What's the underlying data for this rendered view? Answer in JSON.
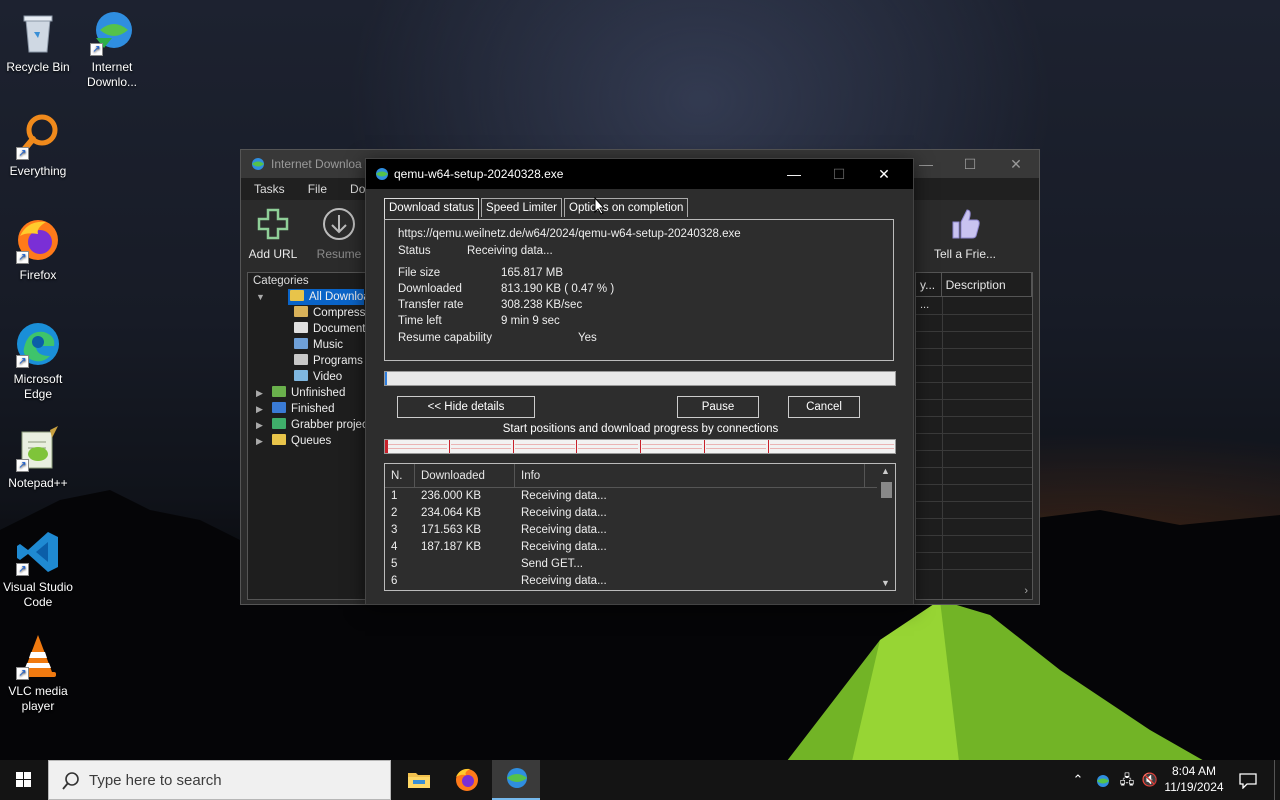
{
  "desktop": {
    "icons": [
      {
        "label": "Recycle Bin",
        "icon": "recycle-bin-icon"
      },
      {
        "label": "Internet Downlo...",
        "icon": "idm-icon"
      },
      {
        "label": "Everything",
        "icon": "everything-search-icon"
      },
      {
        "label": "Firefox",
        "icon": "firefox-icon"
      },
      {
        "label": "Microsoft Edge",
        "icon": "edge-icon"
      },
      {
        "label": "Notepad++",
        "icon": "notepadpp-icon"
      },
      {
        "label": "Visual Studio Code",
        "icon": "vscode-icon"
      },
      {
        "label": "VLC media player",
        "icon": "vlc-icon"
      }
    ]
  },
  "idm_main": {
    "title": "Internet Downloa",
    "menu": [
      "Tasks",
      "File",
      "Dov"
    ],
    "toolbar": {
      "add_url": "Add URL",
      "resume": "Resume",
      "tell_friend": "Tell a Frie..."
    },
    "categories_header": "Categories",
    "tree": [
      {
        "label": "All Downloads",
        "level": 0,
        "expanded": true,
        "selected": true,
        "color": "#e8c44a"
      },
      {
        "label": "Compressed",
        "level": 1,
        "color": "#d9b25a"
      },
      {
        "label": "Documents",
        "level": 1,
        "color": "#e0e0e0"
      },
      {
        "label": "Music",
        "level": 1,
        "color": "#6fa0d8"
      },
      {
        "label": "Programs",
        "level": 1,
        "color": "#c8c8c8"
      },
      {
        "label": "Video",
        "level": 1,
        "color": "#7fb7e0"
      },
      {
        "label": "Unfinished",
        "level": 0,
        "collapsed": true,
        "color": "#6ab04c"
      },
      {
        "label": "Finished",
        "level": 0,
        "collapsed": true,
        "color": "#3a7bd5"
      },
      {
        "label": "Grabber projects",
        "level": 0,
        "collapsed": true,
        "color": "#3fae6a"
      },
      {
        "label": "Queues",
        "level": 0,
        "collapsed": true,
        "color": "#e8c44a"
      }
    ],
    "list_columns": [
      "y...",
      "Description"
    ],
    "list_first_cell": "..."
  },
  "dialog": {
    "title": "qemu-w64-setup-20240328.exe",
    "tabs": [
      "Download status",
      "Speed Limiter",
      "Options on completion"
    ],
    "url": "https://qemu.weilnetz.de/w64/2024/qemu-w64-setup-20240328.exe",
    "status_label": "Status",
    "status_value": "Receiving data...",
    "file_size_label": "File size",
    "file_size_value": "165.817  MB",
    "downloaded_label": "Downloaded",
    "downloaded_value": "813.190  KB  ( 0.47 % )",
    "downloaded_fraction": 0.0047,
    "transfer_rate_label": "Transfer rate",
    "transfer_rate_value": "308.238  KB/sec",
    "time_left_label": "Time left",
    "time_left_value": "9 min 9 sec",
    "resume_label": "Resume capability",
    "resume_value": "Yes",
    "hide_details": "<< Hide details",
    "pause": "Pause",
    "cancel": "Cancel",
    "connections_label": "Start positions and download progress by connections",
    "connection_start_fractions": [
      0,
      0.125,
      0.25,
      0.375,
      0.5,
      0.625,
      0.75
    ],
    "columns": [
      "N.",
      "Downloaded",
      "Info"
    ],
    "rows": [
      {
        "n": "1",
        "downloaded": "236.000  KB",
        "info": "Receiving data..."
      },
      {
        "n": "2",
        "downloaded": "234.064  KB",
        "info": "Receiving data..."
      },
      {
        "n": "3",
        "downloaded": "171.563  KB",
        "info": "Receiving data..."
      },
      {
        "n": "4",
        "downloaded": "187.187  KB",
        "info": "Receiving data..."
      },
      {
        "n": "5",
        "downloaded": "",
        "info": "Send GET..."
      },
      {
        "n": "6",
        "downloaded": "",
        "info": "Receiving data..."
      }
    ]
  },
  "taskbar": {
    "search_placeholder": "Type here to search",
    "time": "8:04 AM",
    "date": "11/19/2024"
  }
}
